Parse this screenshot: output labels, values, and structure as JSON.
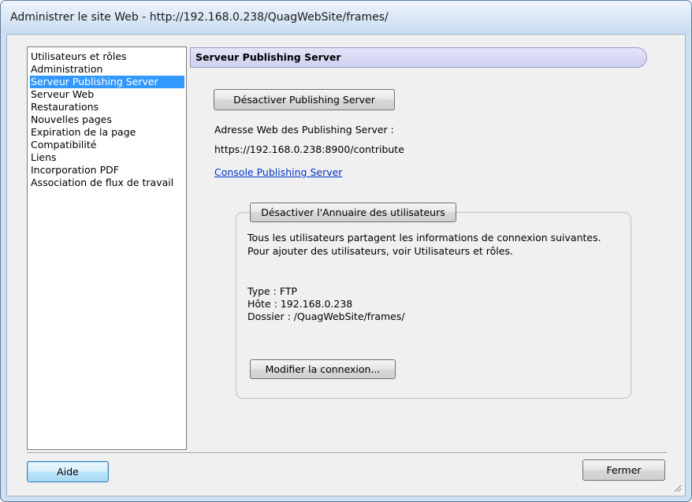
{
  "window": {
    "title": "Administrer le site Web - http://192.168.0.238/QuagWebSite/frames/"
  },
  "nav": {
    "items": [
      {
        "label": "Utilisateurs et rôles",
        "selected": false
      },
      {
        "label": "Administration",
        "selected": false
      },
      {
        "label": "Serveur Publishing Server",
        "selected": true
      },
      {
        "label": "Serveur Web",
        "selected": false
      },
      {
        "label": "Restaurations",
        "selected": false
      },
      {
        "label": "Nouvelles pages",
        "selected": false
      },
      {
        "label": "Expiration de la page",
        "selected": false
      },
      {
        "label": "Compatibilité",
        "selected": false
      },
      {
        "label": "Liens",
        "selected": false
      },
      {
        "label": "Incorporation PDF",
        "selected": false
      },
      {
        "label": "Association de flux de travail",
        "selected": false
      }
    ]
  },
  "panel": {
    "header": "Serveur Publishing Server",
    "deactivate_button": "Désactiver Publishing Server",
    "address_label": "Adresse Web des Publishing Server :",
    "address_value": "https://192.168.0.238:8900/contribute",
    "console_link": "Console Publishing Server",
    "directory": {
      "title_button": "Désactiver l'Annuaire des utilisateurs",
      "description": "Tous les utilisateurs partagent les informations de connexion suivantes. Pour ajouter des utilisateurs, voir Utilisateurs et rôles.",
      "type": "Type : FTP",
      "host": "Hôte : 192.168.0.238",
      "folder": "Dossier : /QuagWebSite/frames/",
      "modify_button": "Modifier la connexion..."
    }
  },
  "footer": {
    "help_button": "Aide",
    "close_button": "Fermer"
  },
  "colors": {
    "selection": "#3399ff",
    "link": "#0033cc",
    "header_fill": "#d8d8f4"
  }
}
